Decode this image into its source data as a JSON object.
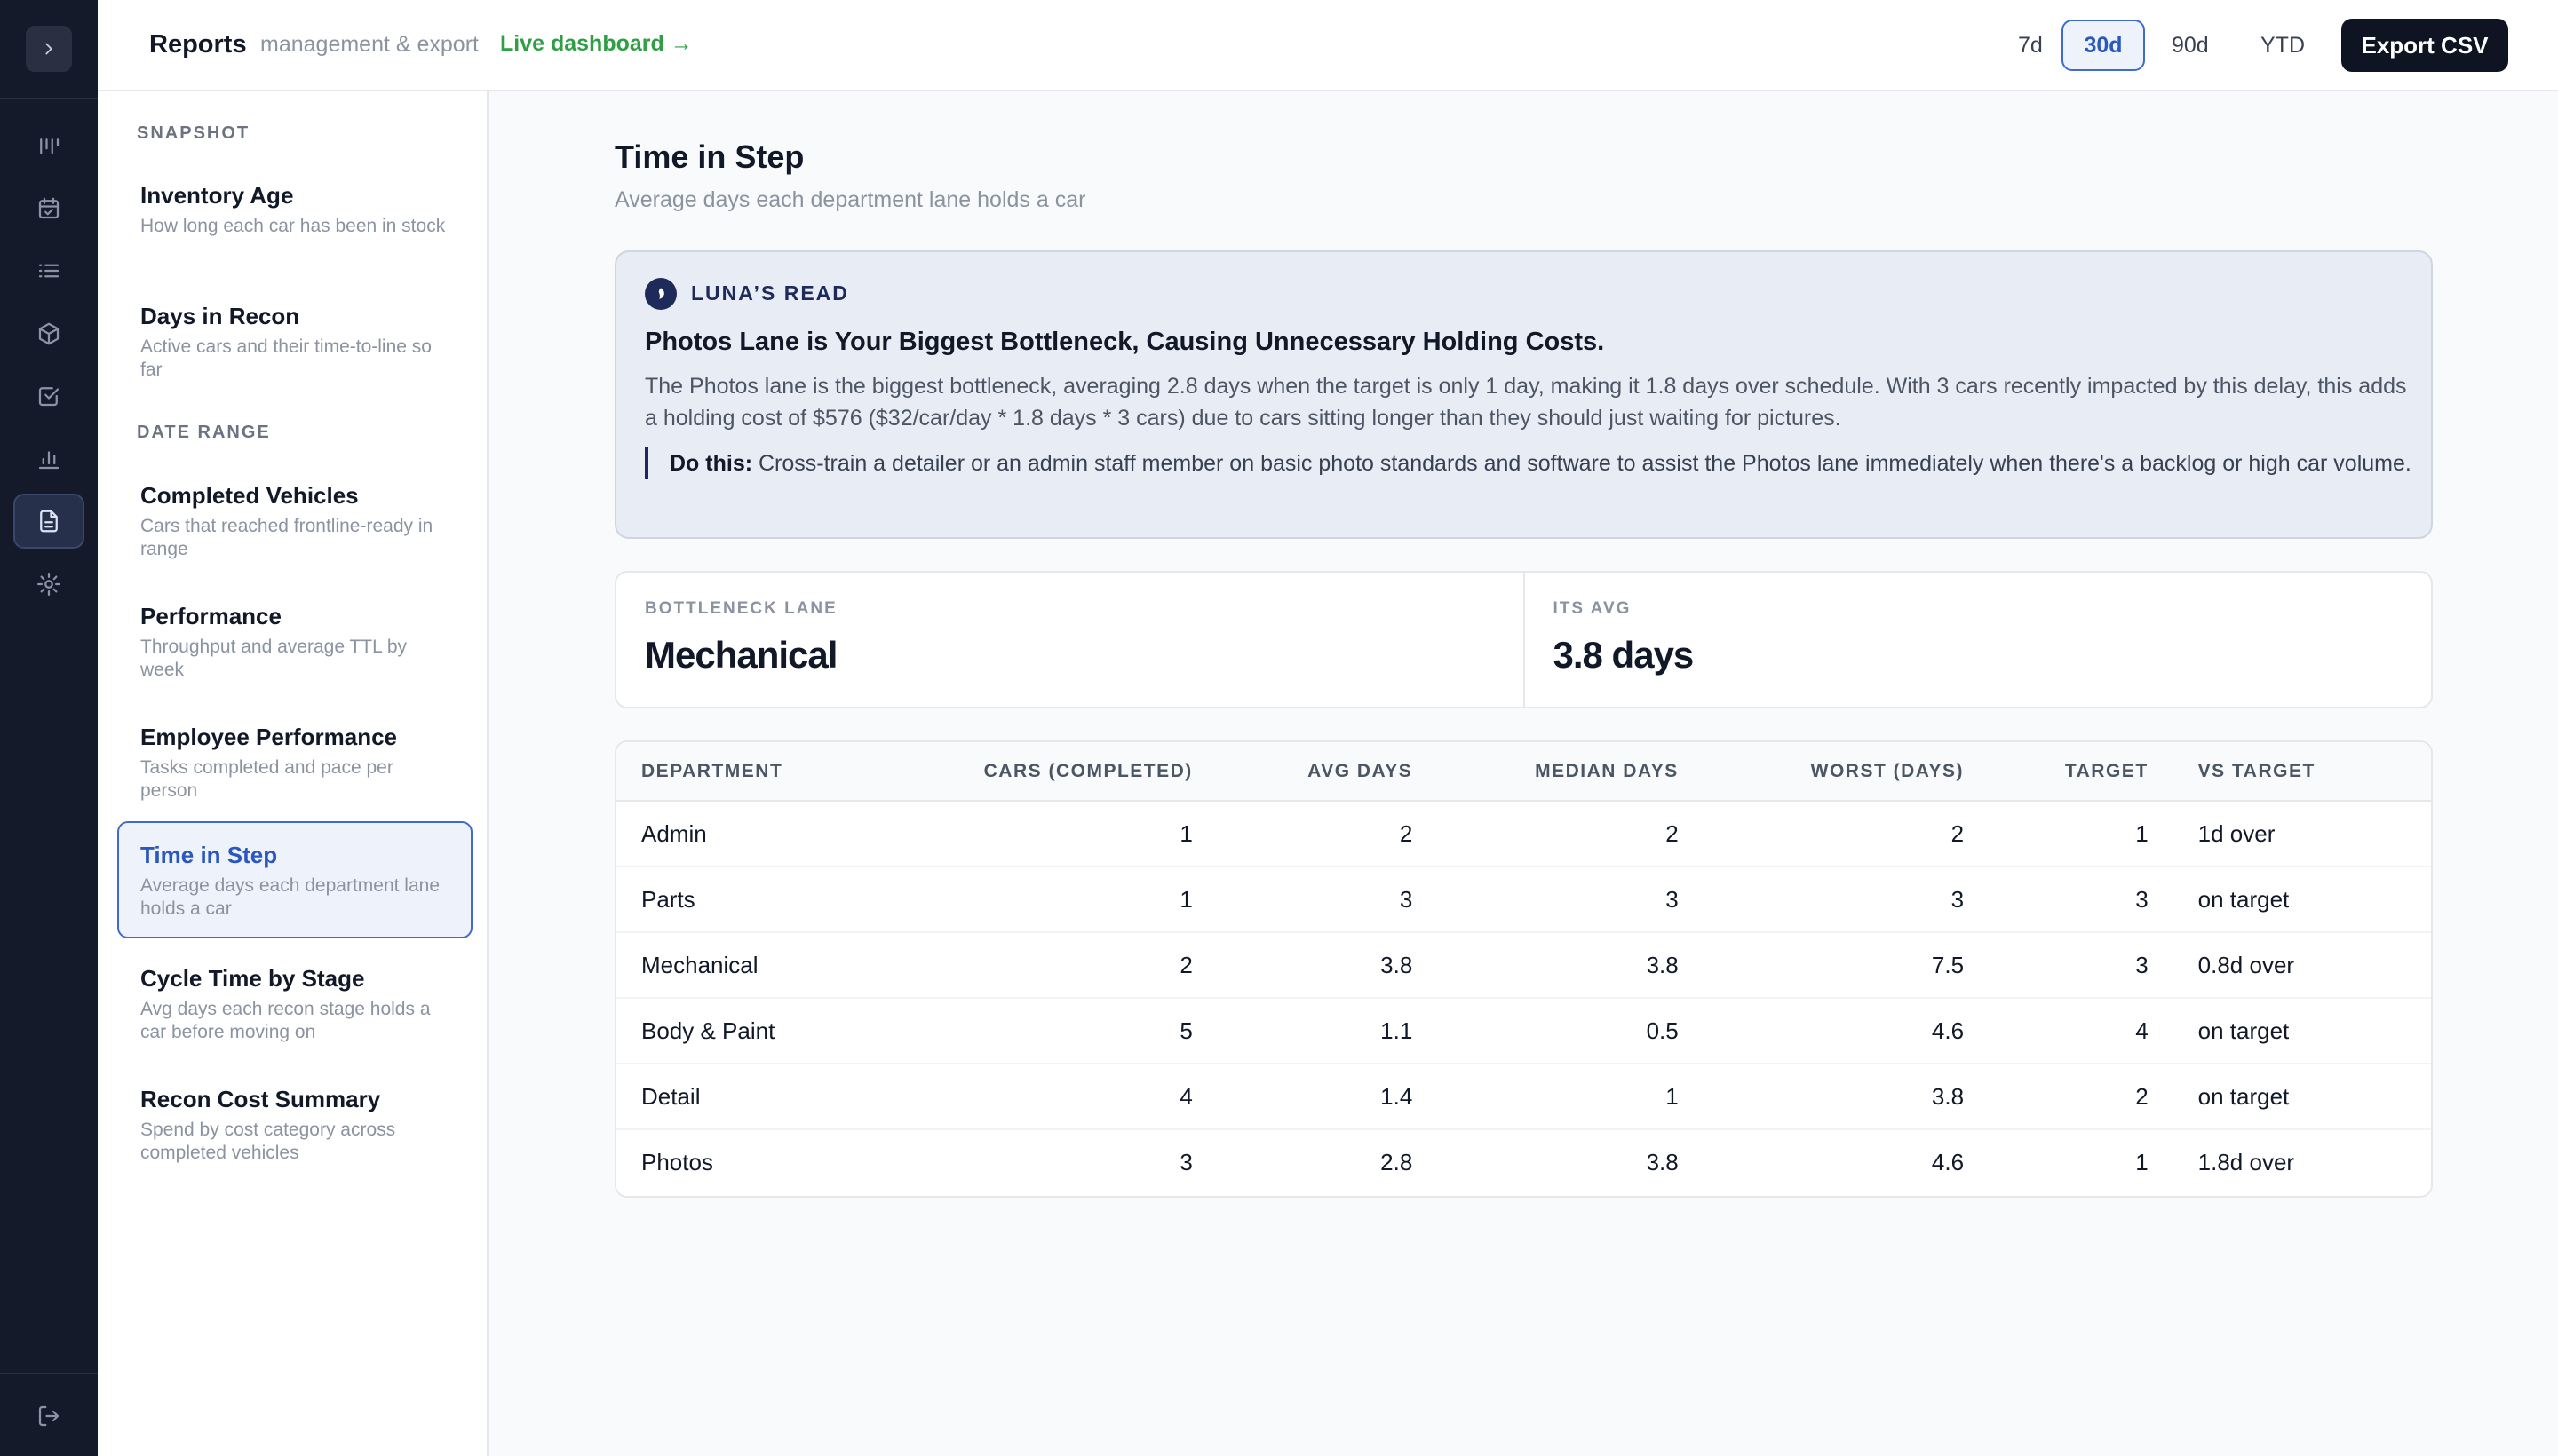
{
  "topbar": {
    "title": "Reports",
    "subtitle": "management & export",
    "live_link": "Live dashboard →",
    "ranges": [
      "7d",
      "30d",
      "90d",
      "YTD"
    ],
    "active_range": "30d",
    "export_label": "Export CSV"
  },
  "rail": {
    "icons": [
      "kanban-icon",
      "calendar-icon",
      "list-icon",
      "box-icon",
      "checkbox-icon",
      "bar-chart-icon",
      "document-icon",
      "gear-icon"
    ],
    "active_icon": "document-icon"
  },
  "sidebar": {
    "sections": [
      {
        "label": "SNAPSHOT",
        "items": [
          {
            "title": "Inventory Age",
            "desc": "How long each car has been in stock"
          },
          {
            "title": "Days in Recon",
            "desc": "Active cars and their time-to-line so far"
          }
        ]
      },
      {
        "label": "DATE RANGE",
        "items": [
          {
            "title": "Completed Vehicles",
            "desc": "Cars that reached frontline-ready in range"
          },
          {
            "title": "Performance",
            "desc": "Throughput and average TTL by week"
          },
          {
            "title": "Employee Performance",
            "desc": "Tasks completed and pace per person"
          },
          {
            "title": "Time in Step",
            "desc": "Average days each department lane holds a car"
          },
          {
            "title": "Cycle Time by Stage",
            "desc": "Avg days each recon stage holds a car before moving on"
          },
          {
            "title": "Recon Cost Summary",
            "desc": "Spend by cost category across completed vehicles"
          }
        ]
      }
    ],
    "active_item": "Time in Step"
  },
  "main": {
    "title": "Time in Step",
    "subtitle": "Average days each department lane holds a car",
    "insight": {
      "label": "LUNA’S READ",
      "headline": "Photos Lane is Your Biggest Bottleneck, Causing Unnecessary Holding Costs.",
      "body": "The Photos lane is the biggest bottleneck, averaging 2.8 days when the target is only 1 day, making it 1.8 days over schedule. With 3 cars recently impacted by this delay, this adds a holding cost of $576 ($32/car/day * 1.8 days * 3 cars) due to cars sitting longer than they should just waiting for pictures.",
      "action_label": "Do this:",
      "action_text": "Cross-train a detailer or an admin staff member on basic photo standards and software to assist the Photos lane immediately when there's a backlog or high car volume."
    },
    "metrics": [
      {
        "label": "BOTTLENECK LANE",
        "value": "Mechanical"
      },
      {
        "label": "ITS AVG",
        "value": "3.8 days"
      }
    ],
    "table": {
      "columns": [
        "DEPARTMENT",
        "CARS (COMPLETED)",
        "AVG DAYS",
        "MEDIAN DAYS",
        "WORST (DAYS)",
        "TARGET",
        "VS TARGET"
      ],
      "rows": [
        [
          "Admin",
          "1",
          "2",
          "2",
          "2",
          "1",
          "1d over"
        ],
        [
          "Parts",
          "1",
          "3",
          "3",
          "3",
          "3",
          "on target"
        ],
        [
          "Mechanical",
          "2",
          "3.8",
          "3.8",
          "7.5",
          "3",
          "0.8d over"
        ],
        [
          "Body & Paint",
          "5",
          "1.1",
          "0.5",
          "4.6",
          "4",
          "on target"
        ],
        [
          "Detail",
          "4",
          "1.4",
          "1",
          "3.8",
          "2",
          "on target"
        ],
        [
          "Photos",
          "3",
          "2.8",
          "3.8",
          "4.6",
          "1",
          "1.8d over"
        ]
      ]
    }
  },
  "colors": {
    "rail_bg": "#151a2b",
    "accent_blue": "#2b58bf",
    "link_green": "#2f9e44",
    "insight_bg": "#e8ecf4",
    "export_bg": "#0f1422"
  }
}
